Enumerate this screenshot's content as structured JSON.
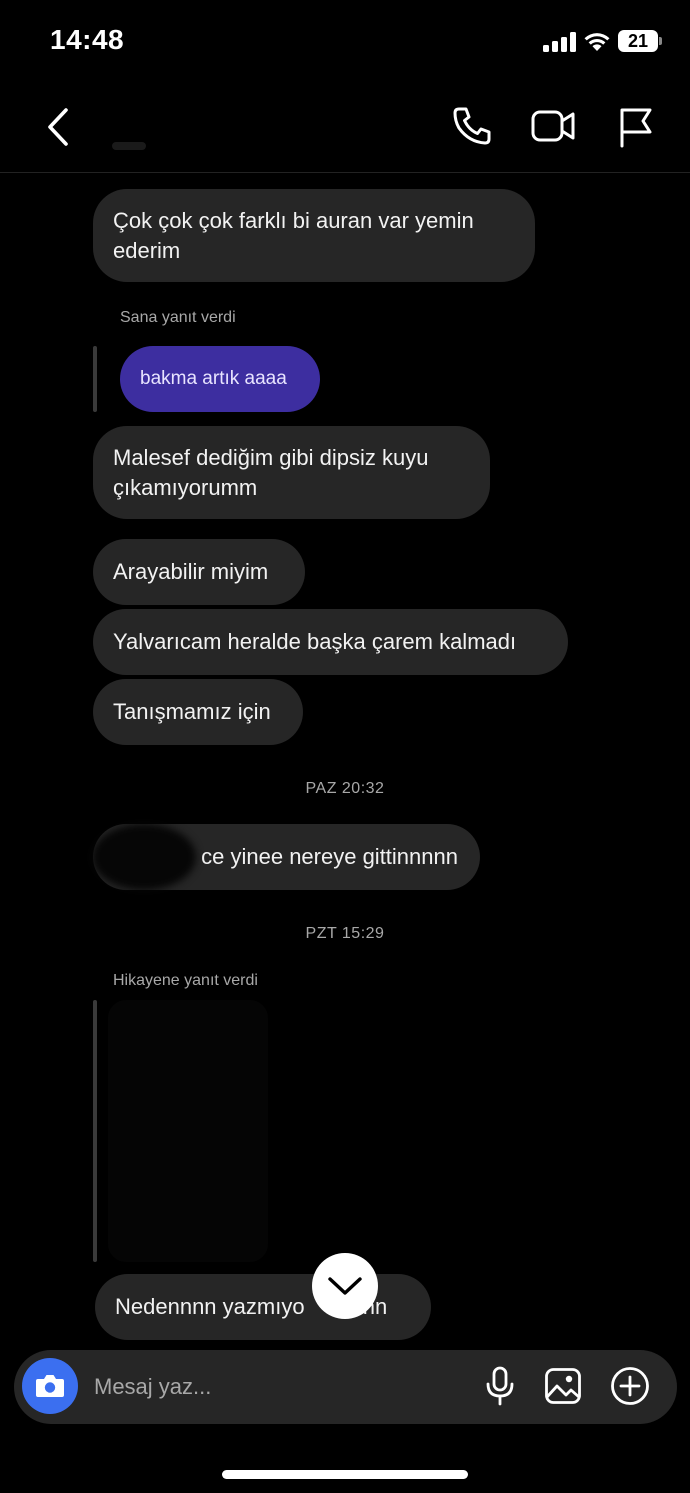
{
  "status_bar": {
    "time": "14:48",
    "battery": "21",
    "icons": [
      "signal-icon",
      "wifi-icon",
      "battery-icon"
    ]
  },
  "header": {
    "icons": [
      "back-arrow-icon",
      "phone-call-icon",
      "video-camera-icon",
      "flag-icon"
    ]
  },
  "messages": [
    {
      "text": "Çok çok çok farklı bi auran var yemin ederim"
    },
    {
      "reply_label": "Sana yanıt verdi",
      "quoted_text": "bakma artık aaaa"
    },
    {
      "text": "Malesef dediğim gibi dipsiz kuyu çıkamıyorumm"
    },
    {
      "text": "Arayabilir miyim"
    },
    {
      "text": "Yalvarıcam heralde başka çarem kalmadı"
    },
    {
      "text": "Tanışmamız için"
    },
    {
      "timestamp": "PAZ 20:32"
    },
    {
      "text": "ce yinee nereye gittinnnnn"
    },
    {
      "timestamp": "PZT 15:29"
    },
    {
      "reply_label": "Hikayene yanıt verdi"
    },
    {
      "text": "Nedennnn yazmıyo",
      "text_tail": "nnn"
    }
  ],
  "composer": {
    "placeholder": "Mesaj yaz...",
    "icons": [
      "camera-icon",
      "microphone-icon",
      "gallery-icon",
      "plus-circle-icon"
    ]
  },
  "colors": {
    "background": "#000000",
    "bubble": "#262626",
    "quoted_bubble": "#3d2ea0",
    "camera_button": "#3b6ff0"
  }
}
